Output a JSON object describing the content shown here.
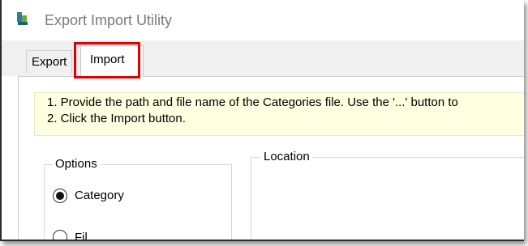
{
  "window": {
    "title": "Export Import Utility"
  },
  "tabs": {
    "export_label": "Export",
    "import_label": "Import",
    "selected": "Import",
    "highlight_color": "#e00000"
  },
  "instructions": {
    "line1": "1. Provide the path and file name of the Categories file. Use the '...' button to",
    "line2": "2. Click the Import button.",
    "background_color": "#ffffe1"
  },
  "options": {
    "legend": "Options",
    "items": [
      {
        "label": "Category",
        "selected": true
      },
      {
        "label": "Fil",
        "selected": false
      }
    ]
  },
  "location": {
    "legend": "Location"
  },
  "icons": {
    "app_icon": "app-icon"
  }
}
